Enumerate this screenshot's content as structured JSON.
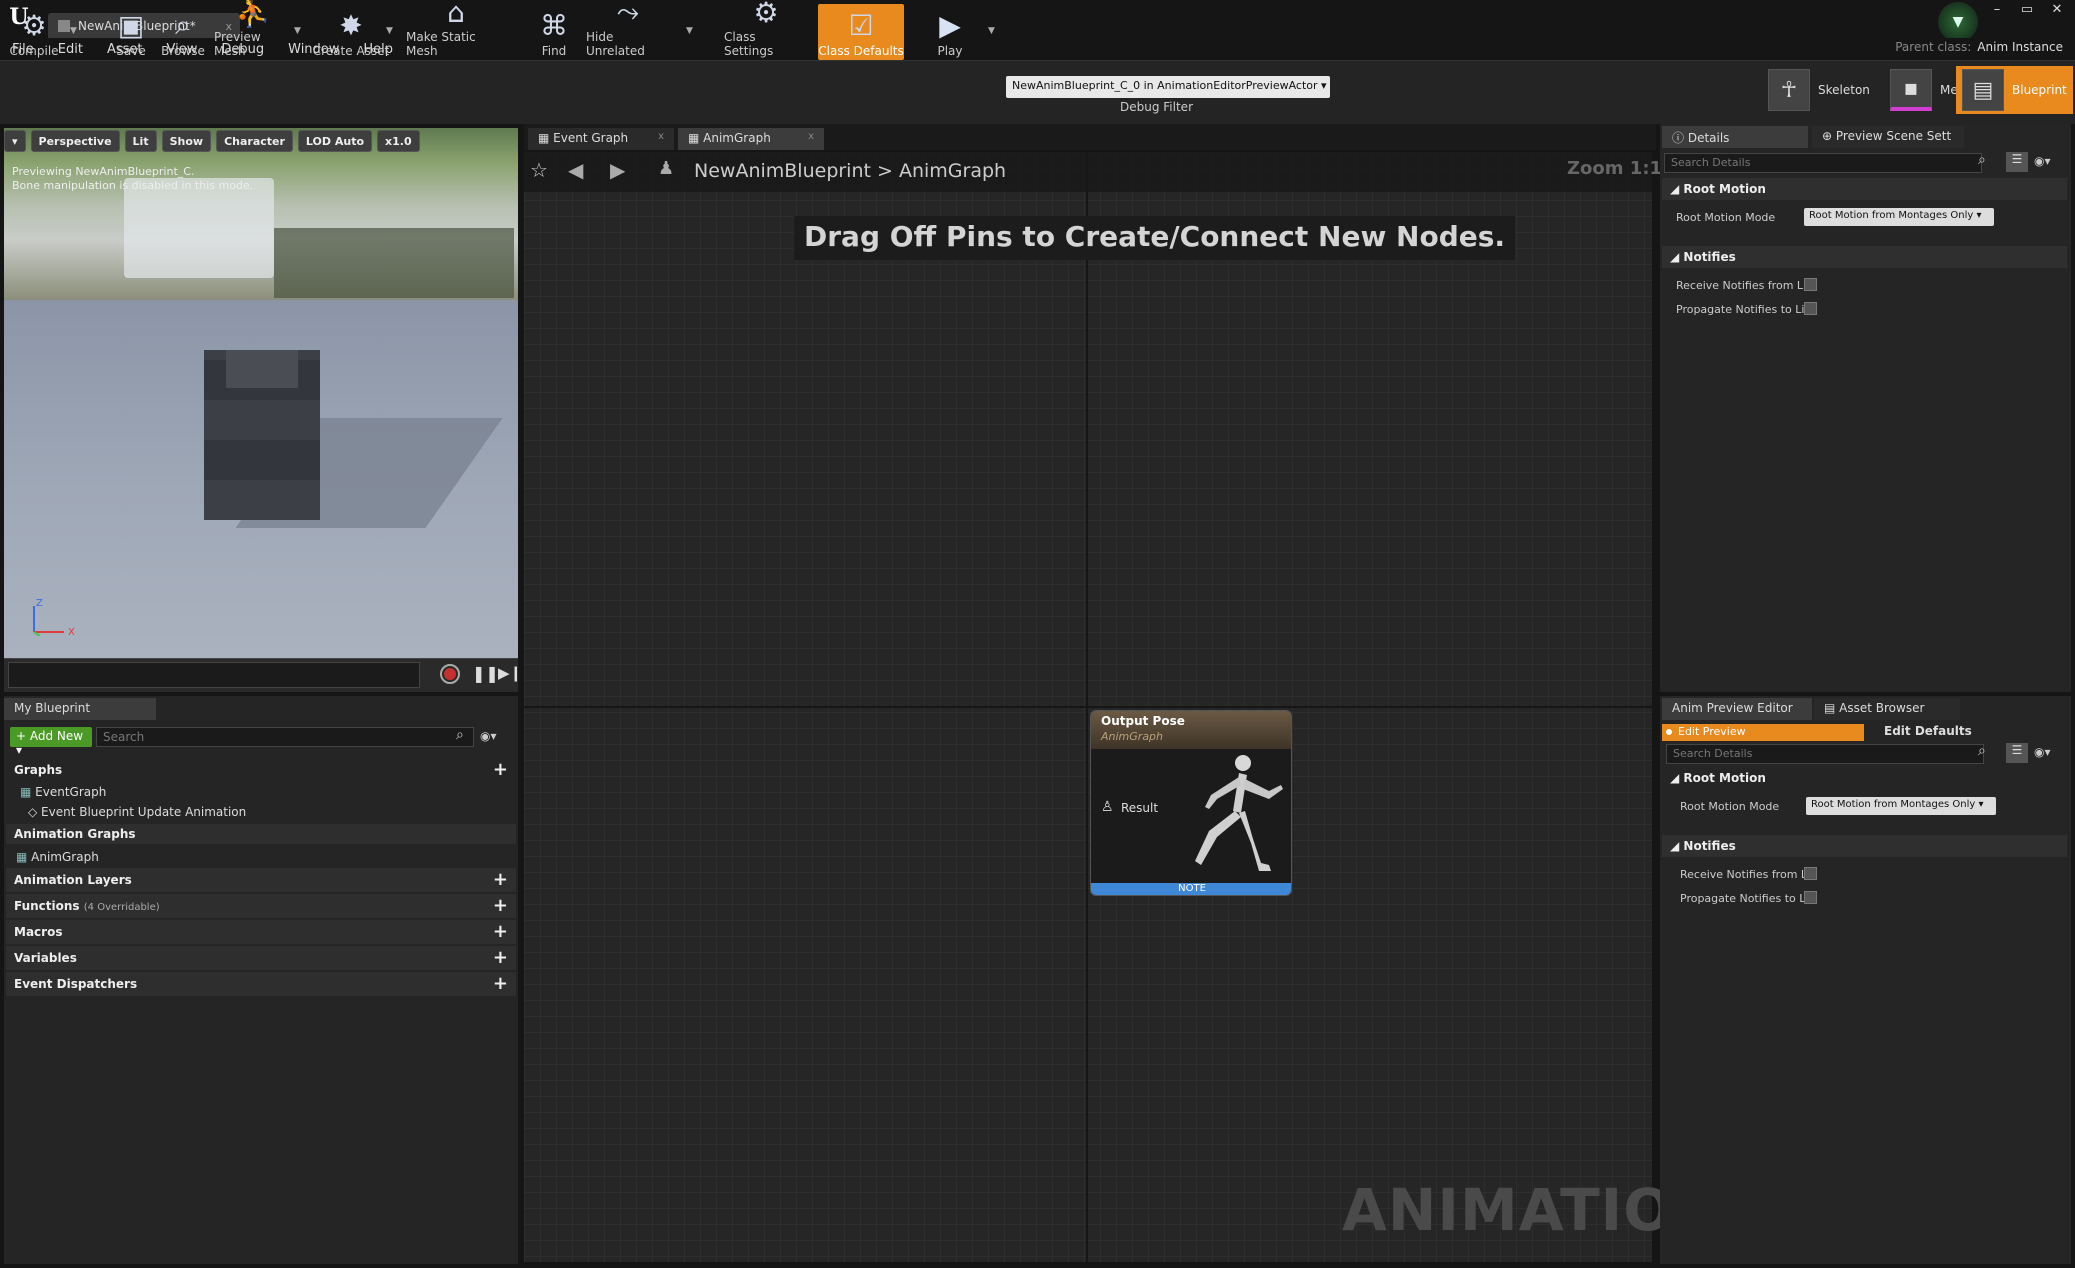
{
  "window": {
    "doc_tab": "NewAnimBlueprint*",
    "close": "x",
    "controls": [
      "–",
      "▭",
      "✕"
    ],
    "parent_class_label": "Parent class:",
    "parent_class_value": "Anim Instance"
  },
  "menu": [
    "File",
    "Edit",
    "Asset",
    "View",
    "Debug",
    "Window",
    "Help"
  ],
  "toolbar": {
    "compile": "Compile",
    "save": "Save",
    "browse": "Browse",
    "preview_mesh": "Preview Mesh",
    "create_asset": "Create Asset",
    "make_static_mesh": "Make Static Mesh",
    "find": "Find",
    "hide_unrelated": "Hide Unrelated",
    "class_settings": "Class Settings",
    "class_defaults": "Class Defaults",
    "play": "Play",
    "debug_select": "NewAnimBlueprint_C_0 in AnimationEditorPreviewActor",
    "debug_filter": "Debug Filter"
  },
  "modes": {
    "skeleton": "Skeleton",
    "mesh": "Mesh",
    "blueprint": "Blueprint"
  },
  "viewport": {
    "buttons": [
      "Perspective",
      "Lit",
      "Show",
      "Character",
      "LOD Auto",
      "x1.0"
    ],
    "info_line1": "Previewing NewAnimBlueprint_C.",
    "info_line2": "Bone manipulation is disabled in this mode.",
    "axis_z": "Z",
    "axis_x": "X"
  },
  "my_blueprint": {
    "tab": "My Blueprint",
    "add_new": "+ Add New ▾",
    "search_placeholder": "Search",
    "graphs": "Graphs",
    "event_graph": "EventGraph",
    "event_update": "Event Blueprint Update Animation",
    "animation_graphs": "Animation Graphs",
    "anim_graph": "AnimGraph",
    "animation_layers": "Animation Layers",
    "functions": "Functions",
    "functions_note": "(4 Overridable)",
    "macros": "Macros",
    "variables": "Variables",
    "event_dispatchers": "Event Dispatchers"
  },
  "graph": {
    "tabs": [
      "Event Graph",
      "AnimGraph"
    ],
    "crumb_root": "NewAnimBlueprint",
    "crumb_sep": ">",
    "crumb_leaf": "AnimGraph",
    "zoom": "Zoom 1:1",
    "hint": "Drag Off Pins to Create/Connect New Nodes.",
    "watermark": "ANIMATION",
    "node": {
      "title": "Output Pose",
      "subtitle": "AnimGraph",
      "pin": "Result",
      "note": "NOTE"
    }
  },
  "details": {
    "tabs": [
      "Details",
      "Preview Scene Sett"
    ],
    "search_placeholder": "Search Details",
    "root_motion": "Root Motion",
    "root_motion_mode": "Root Motion Mode",
    "root_motion_value": "Root Motion from Montages Only ▾",
    "notifies": "Notifies",
    "receive": "Receive Notifies from Li",
    "propagate": "Propagate Notifies to Li"
  },
  "anim_preview": {
    "tabs": [
      "Anim Preview Editor",
      "Asset Browser"
    ],
    "edit_preview": "Edit Preview",
    "edit_defaults": "Edit Defaults",
    "search_placeholder": "Search Details",
    "root_motion": "Root Motion",
    "root_motion_mode": "Root Motion Mode",
    "root_motion_value": "Root Motion from Montages Only ▾",
    "notifies": "Notifies",
    "receive": "Receive Notifies from L",
    "propagate": "Propagate Notifies to Li"
  },
  "colors": {
    "accent": "#e88a1e",
    "add_new": "#4c9a26",
    "note": "#3f88d8"
  }
}
